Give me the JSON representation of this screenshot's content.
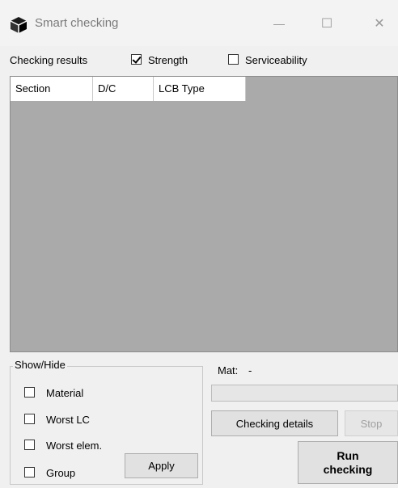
{
  "window": {
    "title": "Smart checking",
    "minimize_glyph": "—",
    "maximize_glyph": "☐",
    "close_glyph": "✕",
    "icon": "cube-icon"
  },
  "toolbar": {
    "checking_results_label": "Checking results",
    "strength_label": "Strength",
    "strength_checked": true,
    "serviceability_label": "Serviceability",
    "serviceability_checked": false
  },
  "grid": {
    "columns": [
      "Section",
      "D/C",
      "LCB Type"
    ],
    "rows": [],
    "background": "#aaaaaa"
  },
  "show_hide": {
    "legend": "Show/Hide",
    "options": [
      {
        "label": "Material",
        "checked": false
      },
      {
        "label": "Worst LC",
        "checked": false
      },
      {
        "label": "Worst elem.",
        "checked": false
      },
      {
        "label": "Group",
        "checked": false
      }
    ],
    "apply_label": "Apply"
  },
  "status": {
    "mat_label": "Mat:",
    "mat_value": "-"
  },
  "actions": {
    "checking_details_label": "Checking details",
    "stop_label": "Stop",
    "run_label_line1": "Run",
    "run_label_line2": "checking"
  }
}
